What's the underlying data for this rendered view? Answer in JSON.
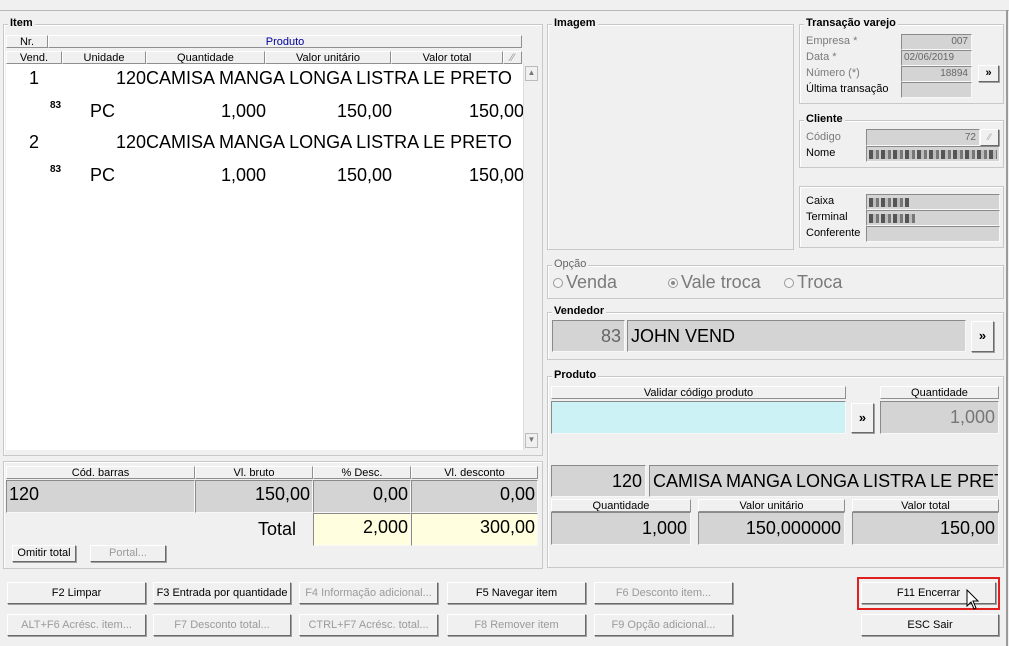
{
  "item_panel": {
    "title": "Item",
    "headers": {
      "nr": "Nr.",
      "produto": "Produto",
      "vend": "Vend.",
      "unidade": "Unidade",
      "quantidade": "Quantidade",
      "valor_unitario": "Valor unitário",
      "valor_total": "Valor total"
    },
    "items": [
      {
        "nr": "1",
        "produto": "120CAMISA MANGA LONGA LISTRA LE PRETO",
        "vend": "83",
        "unidade": "PC",
        "quantidade": "1,000",
        "valor_unitario": "150,00",
        "valor_total": "150,00"
      },
      {
        "nr": "2",
        "produto": "120CAMISA MANGA LONGA LISTRA LE PRETO",
        "vend": "83",
        "unidade": "PC",
        "quantidade": "1,000",
        "valor_unitario": "150,00",
        "valor_total": "150,00"
      }
    ]
  },
  "totals": {
    "headers": {
      "cod_barras": "Cód. barras",
      "vl_bruto": "Vl. bruto",
      "pct_desc": "% Desc.",
      "vl_desconto": "Vl. desconto"
    },
    "cod_barras": "120",
    "vl_bruto": "150,00",
    "pct_desc": "0,00",
    "vl_desconto": "0,00",
    "total_label": "Total",
    "total_quantidade": "2,000",
    "total_valor": "300,00",
    "omitir_total": "Omitir total",
    "portal": "Portal..."
  },
  "imagem": {
    "title": "Imagem"
  },
  "transacao": {
    "title": "Transação varejo",
    "empresa_label": "Empresa *",
    "empresa": "007",
    "data_label": "Data *",
    "data": "02/06/2019",
    "numero_label": "Número (*)",
    "numero": "18894",
    "ultima_label": "Última transação",
    "ultima": ""
  },
  "cliente": {
    "title": "Cliente",
    "codigo_label": "Código",
    "codigo": "72",
    "nome_label": "Nome"
  },
  "caixa": {
    "caixa_label": "Caixa",
    "terminal_label": "Terminal",
    "conferente_label": "Conferente"
  },
  "opcao": {
    "title": "Opção",
    "options": [
      "Venda",
      "Vale troca",
      "Troca"
    ],
    "selected": "Vale troca"
  },
  "vendedor": {
    "title": "Vendedor",
    "codigo": "83",
    "nome": "JOHN VEND"
  },
  "produto": {
    "title": "Produto",
    "validar_label": "Validar código produto",
    "codigo_input": "",
    "quantidade_label": "Quantidade",
    "quantidade": "1,000",
    "codigo": "120",
    "descricao": "CAMISA MANGA LONGA LISTRA LE PRETO",
    "qtd_label": "Quantidade",
    "qtd": "1,000",
    "valor_unitario_label": "Valor unitário",
    "valor_unitario": "150,000000",
    "valor_total_label": "Valor total",
    "valor_total": "150,00"
  },
  "buttons": {
    "f2": "F2 Limpar",
    "f3": "F3 Entrada por quantidade",
    "f4": "F4 Informação adicional...",
    "f5": "F5 Navegar item",
    "f6": "F6 Desconto item...",
    "f11": "F11 Encerrar",
    "alt_f6": "ALT+F6 Acrésc. item...",
    "f7": "F7 Desconto total...",
    "ctrl_f7": "CTRL+F7 Acrésc. total...",
    "f8": "F8 Remover item",
    "f9": "F9 Opção adicional...",
    "esc": "ESC Sair"
  },
  "chevron": "»",
  "colors": {
    "highlight_border": "#e02020",
    "input_cyan": "#ccf2f6",
    "total_yellow": "#ffffe0",
    "link_blue": "#0000a0"
  }
}
